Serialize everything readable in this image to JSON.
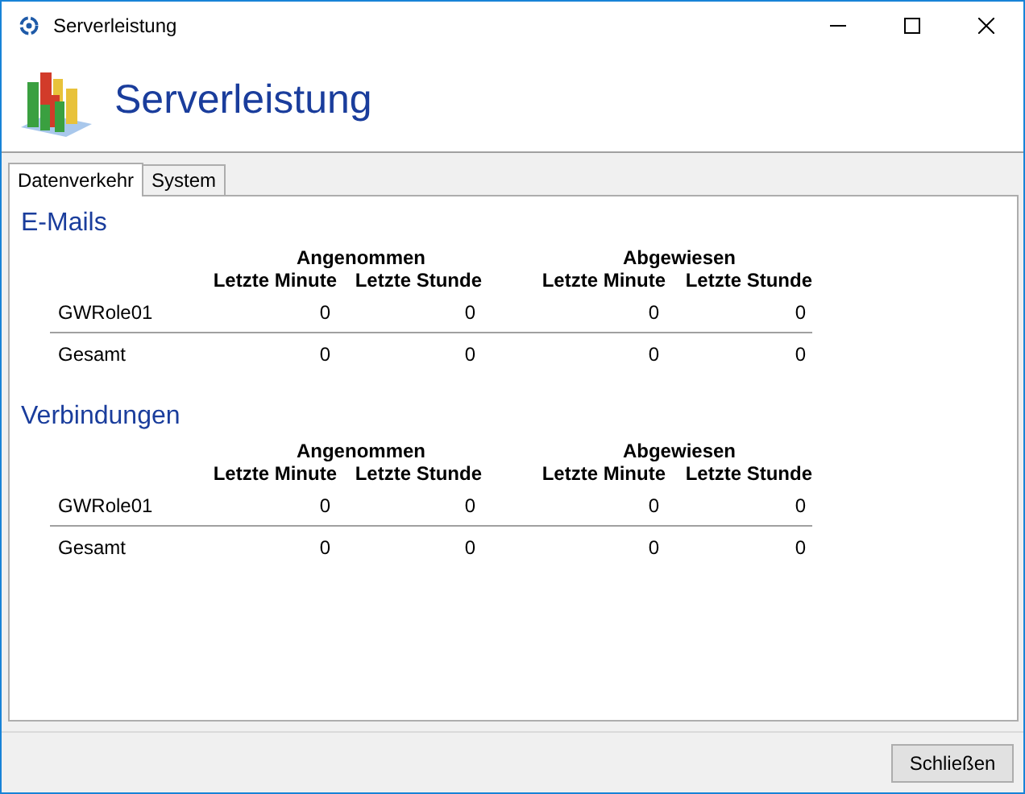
{
  "window": {
    "title": "Serverleistung"
  },
  "header": {
    "title": "Serverleistung"
  },
  "tabs": [
    {
      "label": "Datenverkehr",
      "selected": true
    },
    {
      "label": "System",
      "selected": false
    }
  ],
  "sections": [
    {
      "title": "E-Mails",
      "groups": [
        "Angenommen",
        "Abgewiesen"
      ],
      "columns": [
        "Letzte Minute",
        "Letzte Stunde",
        "Letzte Minute",
        "Letzte Stunde"
      ],
      "rows": [
        {
          "label": "GWRole01",
          "values": [
            "0",
            "0",
            "0",
            "0"
          ]
        },
        {
          "label": "Gesamt",
          "values": [
            "0",
            "0",
            "0",
            "0"
          ]
        }
      ]
    },
    {
      "title": "Verbindungen",
      "groups": [
        "Angenommen",
        "Abgewiesen"
      ],
      "columns": [
        "Letzte Minute",
        "Letzte Stunde",
        "Letzte Minute",
        "Letzte Stunde"
      ],
      "rows": [
        {
          "label": "GWRole01",
          "values": [
            "0",
            "0",
            "0",
            "0"
          ]
        },
        {
          "label": "Gesamt",
          "values": [
            "0",
            "0",
            "0",
            "0"
          ]
        }
      ]
    }
  ],
  "buttons": [
    "Schließen"
  ]
}
